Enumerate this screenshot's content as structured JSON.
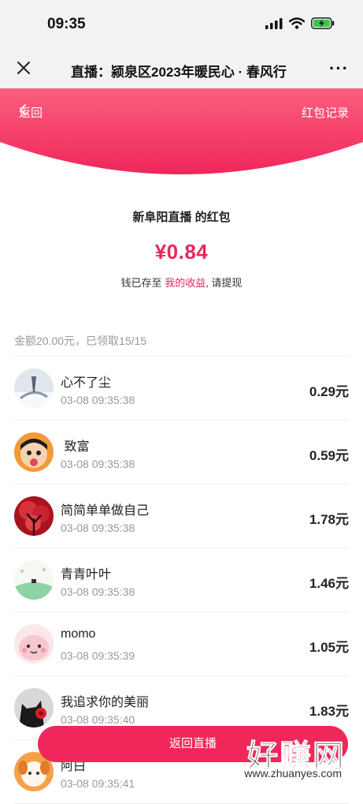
{
  "status": {
    "time": "09:35"
  },
  "nav": {
    "title": "直播：颍泉区2023年暖民心 · 春风行",
    "more": "···"
  },
  "header": {
    "back_label": "返回",
    "record_label": "红包记录",
    "brand_color": "#f0275a"
  },
  "packet": {
    "sender": "新阜阳直播 的红包",
    "amount": "¥0.84",
    "note_prefix": "钱已存至",
    "note_link": "我的收益",
    "note_suffix": ", 请提现"
  },
  "summary": "金额20.00元，已领取15/15",
  "recipients": [
    {
      "name": "心不了尘",
      "time": "03-08 09:35:38",
      "amount": "0.29元",
      "avatar": "snow-scene-avatar"
    },
    {
      "name": " 致富",
      "time": "03-08 09:35:38",
      "amount": "0.59元",
      "avatar": "cartoon-boy-avatar"
    },
    {
      "name": "简简单单做自己",
      "time": "03-08 09:35:38",
      "amount": "1.78元",
      "avatar": "red-tree-avatar"
    },
    {
      "name": "青青叶叶",
      "time": "03-08 09:35:38",
      "amount": "1.46元",
      "avatar": "green-hill-avatar"
    },
    {
      "name": "momo",
      "time": "03-08 09:35:39",
      "amount": "1.05元",
      "avatar": "pink-character-avatar"
    },
    {
      "name": "我追求你的美丽",
      "time": "03-08 09:35:40",
      "amount": "1.83元",
      "avatar": "cat-flower-avatar"
    },
    {
      "name": "阿白",
      "time": "03-08 09:35:41",
      "amount": "",
      "avatar": "puppy-avatar"
    }
  ],
  "bottom_button": "返回直播",
  "watermark": {
    "brand": "好赚网",
    "url": "www.zhuanyes.com"
  }
}
